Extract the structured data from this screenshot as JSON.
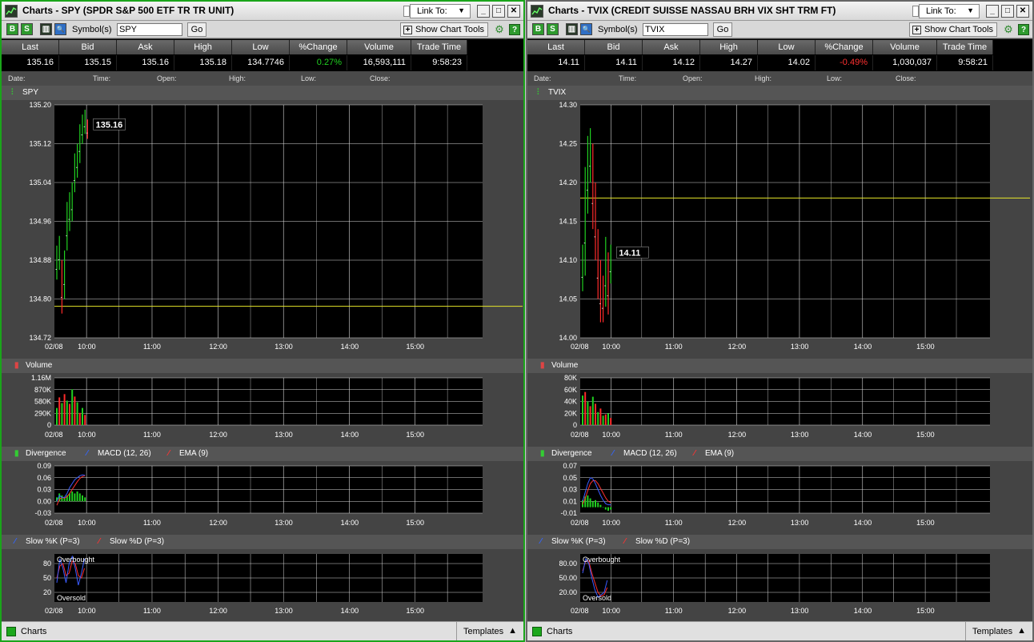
{
  "app": {
    "link_to_label": "Link To:",
    "symbol_label": "Symbol(s)",
    "go_label": "Go",
    "show_tools_label": "Show Chart Tools"
  },
  "quote_headers": [
    "Last",
    "Bid",
    "Ask",
    "High",
    "Low",
    "%Change",
    "Volume",
    "Trade Time"
  ],
  "ohlc_labels": [
    "Date:",
    "Time:",
    "Open:",
    "High:",
    "Low:",
    "Close:"
  ],
  "windows": [
    {
      "title": "Charts - SPY (SPDR S&P 500 ETF TR TR UNIT)",
      "symbol": "SPY",
      "quote": [
        "135.16",
        "135.15",
        "135.16",
        "135.18",
        "134.7746",
        "0.27%",
        "16,593,111",
        "9:58:23"
      ],
      "pct_dir": "up",
      "status_label": "Charts",
      "templates_label": "Templates",
      "xaxis": [
        "02/08",
        "10:00",
        "11:00",
        "12:00",
        "13:00",
        "14:00",
        "15:00"
      ],
      "price": {
        "legend": "SPY",
        "ticks": [
          "135.20",
          "135.12",
          "135.04",
          "134.96",
          "134.88",
          "134.80",
          "134.72"
        ],
        "ymin": 134.72,
        "ymax": 135.2,
        "last_label": "135.16",
        "last_value": 135.16,
        "ref_value": 134.785,
        "bars": [
          [
            134.91,
            134.84
          ],
          [
            134.93,
            134.86
          ],
          [
            134.88,
            134.77
          ],
          [
            134.9,
            134.8
          ],
          [
            135.0,
            134.9
          ],
          [
            135.02,
            134.94
          ],
          [
            135.04,
            134.96
          ],
          [
            135.1,
            135.02
          ],
          [
            135.12,
            135.05
          ],
          [
            135.16,
            135.08
          ],
          [
            135.18,
            135.12
          ],
          [
            135.19,
            135.14
          ],
          [
            135.17,
            135.13
          ]
        ]
      },
      "volume": {
        "legend": "Volume",
        "ticks": [
          "1.16M",
          "870K",
          "580K",
          "290K",
          "0"
        ],
        "ymax": 1160000,
        "values": [
          420000,
          680000,
          540000,
          760000,
          600000,
          520000,
          880000,
          700000,
          560000,
          300000,
          420000,
          250000
        ]
      },
      "macd": {
        "legend_div": "Divergence",
        "legend_macd": "MACD (12, 26)",
        "legend_ema": "EMA (9)",
        "ticks": [
          "0.09",
          "0.06",
          "0.03",
          "0.00",
          "-0.03"
        ],
        "ymin": -0.03,
        "ymax": 0.09,
        "hist": [
          0.01,
          0.02,
          0.015,
          0.01,
          0.015,
          0.02,
          0.025,
          0.02,
          0.025,
          0.02,
          0.015,
          0.01
        ],
        "macd_line": [
          0.0,
          0.015,
          0.01,
          0.01,
          0.02,
          0.035,
          0.045,
          0.055,
          0.06,
          0.065,
          0.067,
          0.066
        ],
        "ema_line": [
          -0.01,
          0.005,
          0.01,
          0.008,
          0.012,
          0.02,
          0.03,
          0.04,
          0.05,
          0.058,
          0.063,
          0.065
        ]
      },
      "stoch": {
        "legend_k": "Slow %K (P=3)",
        "legend_d": "Slow %D (P=3)",
        "ticks": [
          "80",
          "50",
          "20"
        ],
        "overbought": "Overbought",
        "oversold": "Oversold",
        "k_line": [
          40,
          90,
          70,
          40,
          80,
          95,
          70,
          35,
          60,
          90
        ],
        "d_line": [
          50,
          75,
          80,
          55,
          60,
          85,
          80,
          55,
          50,
          70
        ]
      }
    },
    {
      "title": "Charts - TVIX (CREDIT SUISSE NASSAU BRH VIX SHT TRM FT)",
      "symbol": "TVIX",
      "quote": [
        "14.11",
        "14.11",
        "14.12",
        "14.27",
        "14.02",
        "-0.49%",
        "1,030,037",
        "9:58:21"
      ],
      "pct_dir": "dn",
      "status_label": "Charts",
      "templates_label": "Templates",
      "xaxis": [
        "02/08",
        "10:00",
        "11:00",
        "12:00",
        "13:00",
        "14:00",
        "15:00"
      ],
      "price": {
        "legend": "TVIX",
        "ticks": [
          "14.30",
          "14.25",
          "14.20",
          "14.15",
          "14.10",
          "14.05",
          "14.00"
        ],
        "ymin": 14.0,
        "ymax": 14.3,
        "last_label": "14.11",
        "last_value": 14.11,
        "ref_value": 14.18,
        "bars": [
          [
            14.12,
            14.06
          ],
          [
            14.22,
            14.08
          ],
          [
            14.26,
            14.16
          ],
          [
            14.27,
            14.2
          ],
          [
            14.25,
            14.14
          ],
          [
            14.2,
            14.1
          ],
          [
            14.14,
            14.05
          ],
          [
            14.1,
            14.02
          ],
          [
            14.08,
            14.02
          ],
          [
            14.13,
            14.04
          ],
          [
            14.11,
            14.03
          ],
          [
            14.12,
            14.07
          ]
        ]
      },
      "volume": {
        "legend": "Volume",
        "ticks": [
          "80K",
          "60K",
          "40K",
          "20K",
          "0"
        ],
        "ymax": 80000,
        "values": [
          50000,
          56000,
          40000,
          32000,
          48000,
          36000,
          22000,
          28000,
          16000,
          18000,
          20000,
          12000
        ]
      },
      "macd": {
        "legend_div": "Divergence",
        "legend_macd": "MACD (12, 26)",
        "legend_ema": "EMA (9)",
        "ticks": [
          "0.07",
          "0.05",
          "0.03",
          "0.01",
          "-0.01"
        ],
        "ymin": -0.01,
        "ymax": 0.07,
        "hist": [
          0.012,
          0.018,
          0.02,
          0.015,
          0.01,
          0.012,
          0.008,
          0.004,
          0.0,
          -0.004,
          -0.006,
          -0.004
        ],
        "macd_line": [
          0.01,
          0.025,
          0.04,
          0.05,
          0.048,
          0.04,
          0.03,
          0.02,
          0.012,
          0.006,
          0.004,
          0.004
        ],
        "ema_line": [
          0.005,
          0.015,
          0.028,
          0.04,
          0.045,
          0.045,
          0.04,
          0.032,
          0.024,
          0.016,
          0.01,
          0.008
        ]
      },
      "stoch": {
        "legend_k": "Slow %K (P=3)",
        "legend_d": "Slow %D (P=3)",
        "ticks": [
          "80.00",
          "50.00",
          "20.00"
        ],
        "overbought": "Overbought",
        "oversold": "Oversold",
        "k_line": [
          60,
          90,
          80,
          50,
          25,
          10,
          15,
          20,
          45
        ],
        "d_line": [
          65,
          85,
          85,
          60,
          40,
          20,
          12,
          15,
          30
        ]
      }
    }
  ],
  "colors": {
    "up": "#20d020",
    "down": "#ff2a2a",
    "macd": "#3a5cff",
    "ema": "#ff3030",
    "ref_line": "#e6e62a",
    "grid": "#d8d8d8"
  }
}
